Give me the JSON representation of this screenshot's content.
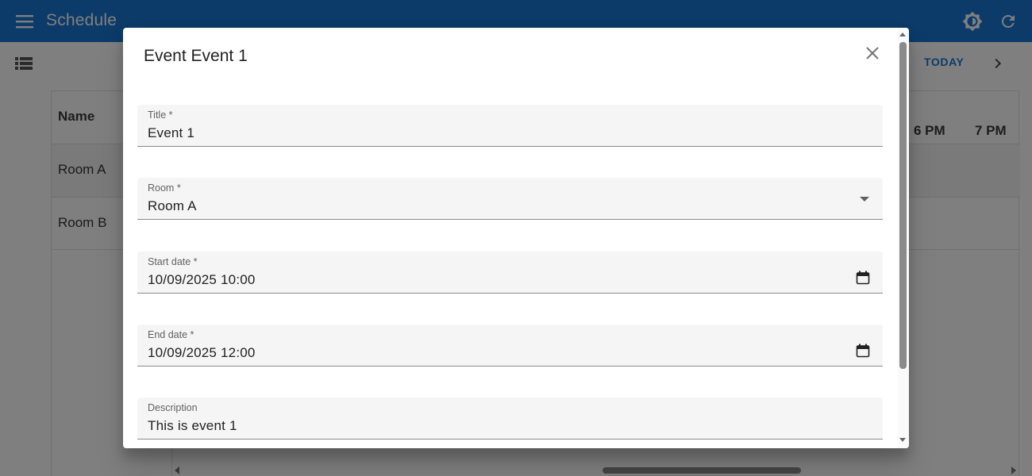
{
  "app": {
    "title": "Schedule",
    "accent_color": "#1976d2",
    "icons": {
      "menu": "menu-icon",
      "brightness": "brightness-icon",
      "refresh": "refresh-icon"
    }
  },
  "toolbar": {
    "today_label": "TODAY",
    "icons": {
      "view": "list-view-icon",
      "next": "chevron-right-icon"
    }
  },
  "timeline": {
    "name_header": "Name",
    "rows": [
      {
        "label": "Room A"
      },
      {
        "label": "Room B"
      }
    ],
    "hours": [
      "6 PM",
      "7 PM"
    ]
  },
  "dialog": {
    "title": "Event Event 1",
    "fields": {
      "title": {
        "label": "Title *",
        "value": "Event 1"
      },
      "room": {
        "label": "Room *",
        "value": "Room A"
      },
      "start_date": {
        "label": "Start date *",
        "value": "10/09/2025 10:00"
      },
      "end_date": {
        "label": "End date *",
        "value": "10/09/2025 12:00"
      },
      "description": {
        "label": "Description",
        "value": "This is event 1"
      }
    },
    "icons": {
      "close": "close-icon",
      "calendar": "calendar-icon",
      "dropdown": "chevron-down-icon"
    }
  }
}
